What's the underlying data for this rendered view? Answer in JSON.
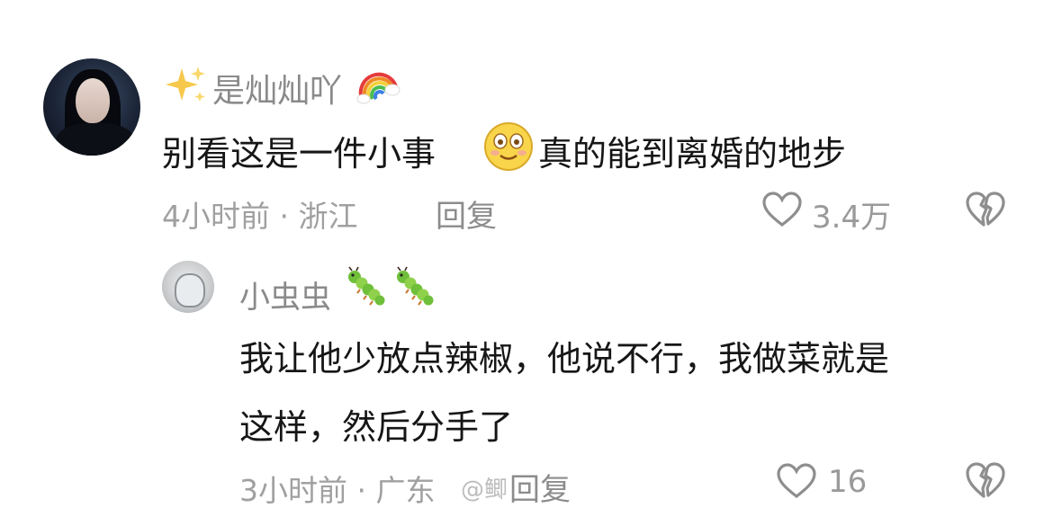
{
  "main_comment": {
    "nickname": "是灿灿吖",
    "text_before_emoji": "别看这是一件小事",
    "text_after_emoji": "真的能到离婚的地步",
    "meta": "4小时前 · 浙江",
    "reply_label": "回复",
    "like_count": "3.4万",
    "icons": [
      "sparkle-icon",
      "rainbow-icon",
      "smile-icon",
      "like-icon",
      "dislike-icon"
    ]
  },
  "reply_comment": {
    "nickname": "小虫虫",
    "text_line1": "我让他少放点辣椒，他说不行，我做菜就是",
    "text_line2": "这样，然后分手了",
    "meta": "3小时前 · 广东",
    "reply_label": "回复",
    "like_count": "16",
    "icons": [
      "caterpillar-icon",
      "caterpillar-icon",
      "like-icon",
      "dislike-icon"
    ]
  },
  "watermark": "@鲫"
}
